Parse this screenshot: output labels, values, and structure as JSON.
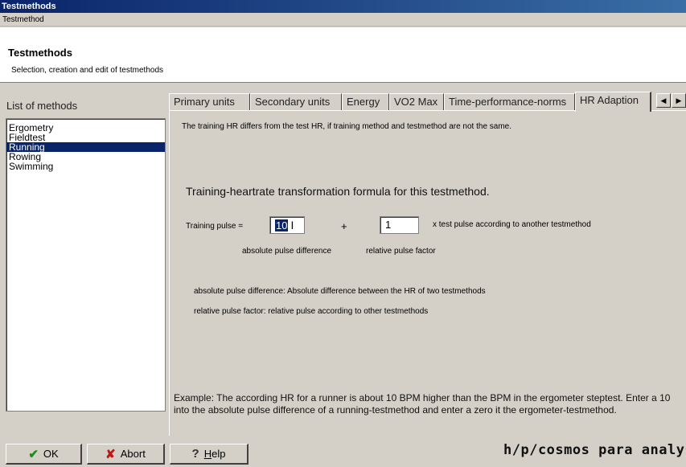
{
  "window": {
    "title": "Testmethods"
  },
  "menu": {
    "item": "Testmethod"
  },
  "header": {
    "title": "Testmethods",
    "subtitle": "Selection, creation and edit of testmethods"
  },
  "methods": {
    "label": "List of methods",
    "items": [
      "Ergometry",
      "Fieldtest",
      "Running",
      "Rowing",
      "Swimming"
    ],
    "selected": "Running"
  },
  "tabs": {
    "items": [
      "Primary units",
      "Secondary units",
      "Energy",
      "VO2 Max",
      "Time-performance-norms",
      "HR Adaption"
    ],
    "active": "HR Adaption",
    "scroll_left": "◀",
    "scroll_right": "▶"
  },
  "hr_adaption": {
    "info": "The training HR differs from the test HR, if training method and testmethod are not the same.",
    "formula_title": "Training-heartrate transformation formula for this testmethod.",
    "training_pulse_label": "Training pulse =",
    "absolute_value": "10",
    "plus": "+",
    "relative_value": "1",
    "suffix": "x test pulse according to another testmethod",
    "absolute_caption": "absolute pulse difference",
    "relative_caption": "relative pulse factor",
    "def_absolute": "absolute pulse difference: Absolute difference between the HR of two testmethods",
    "def_relative": "relative pulse factor: relative pulse according to other testmethods",
    "example": "Example: The according HR for a runner is about 10 BPM higher than the BPM in the ergometer steptest. Enter a 10 into the absolute pulse difference of a running-testmethod and enter a zero it the ergometer-testmethod."
  },
  "buttons": {
    "ok": "OK",
    "abort": "Abort",
    "help_prefix": "",
    "help_underline": "H",
    "help_rest": "elp"
  },
  "brand": "h/p/cosmos para analysis®",
  "colors": {
    "selection": "#0a246a",
    "titlebar": "#0a246a",
    "face": "#d4d0c8"
  }
}
